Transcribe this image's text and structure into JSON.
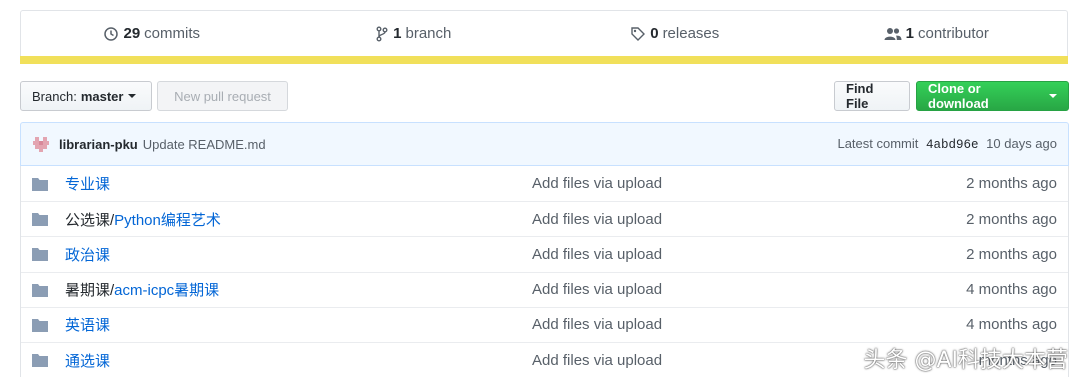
{
  "summary": {
    "commits": {
      "count": "29",
      "label": "commits",
      "icon": "history-icon"
    },
    "branches": {
      "count": "1",
      "label": "branch",
      "icon": "git-branch-icon"
    },
    "releases": {
      "count": "0",
      "label": "releases",
      "icon": "tag-icon"
    },
    "contributors": {
      "count": "1",
      "label": "contributor",
      "icon": "people-icon"
    }
  },
  "language_bar_color": "#f1e05a",
  "toolbar": {
    "branch_prefix": "Branch:",
    "branch_name": "master",
    "new_pr_label": "New pull request",
    "find_file_label": "Find File",
    "clone_label": "Clone or download"
  },
  "latest_commit": {
    "author": "librarian-pku",
    "message": "Update README.md",
    "prefix": "Latest commit",
    "sha": "4abd96e",
    "age": "10 days ago"
  },
  "files": [
    {
      "plain": "",
      "link": "专业课",
      "message": "Add files via upload",
      "age": "2 months ago"
    },
    {
      "plain": "公选课/",
      "link": "Python编程艺术",
      "message": "Add files via upload",
      "age": "2 months ago"
    },
    {
      "plain": "",
      "link": "政治课",
      "message": "Add files via upload",
      "age": "2 months ago"
    },
    {
      "plain": "暑期课/",
      "link": "acm-icpc暑期课",
      "message": "Add files via upload",
      "age": "4 months ago"
    },
    {
      "plain": "",
      "link": "英语课",
      "message": "Add files via upload",
      "age": "4 months ago"
    },
    {
      "plain": "",
      "link": "通选课",
      "message": "Add files via upload",
      "age": "months ago"
    }
  ],
  "watermark": "头条 @AI科技大本营",
  "colors": {
    "link": "#0366d6",
    "clone_button": "#28a745",
    "commit_bar_bg": "#f1f8ff"
  }
}
